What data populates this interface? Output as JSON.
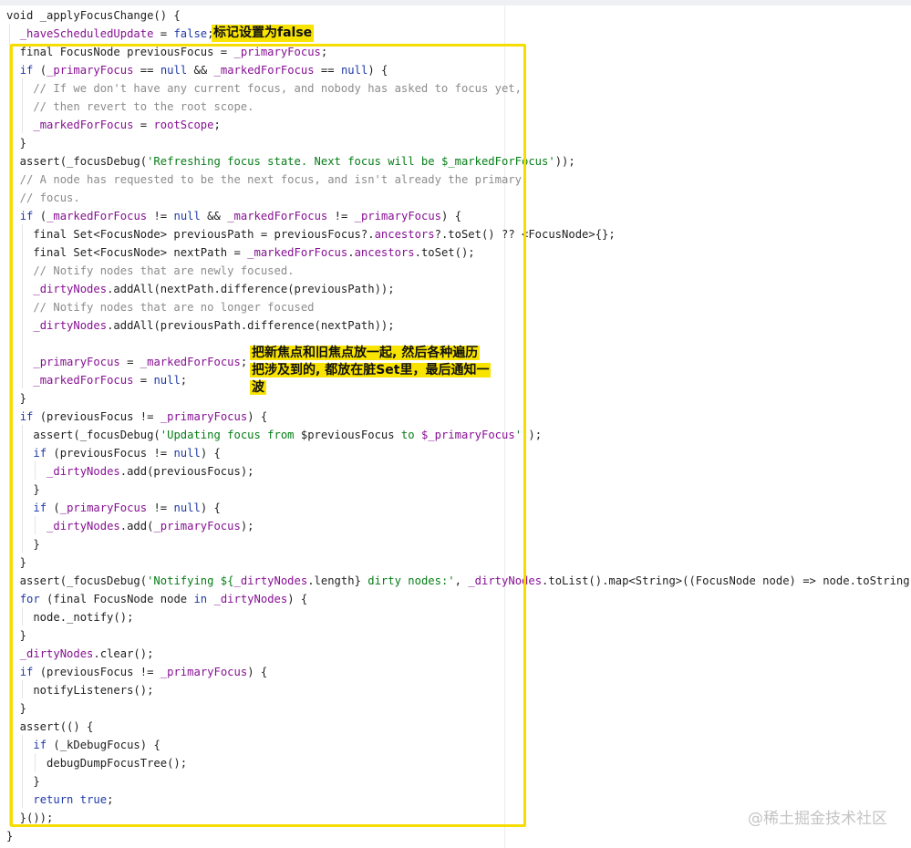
{
  "editor": {
    "lines": [
      [
        {
          "t": "void _applyFocusChange() {",
          "c": ""
        }
      ],
      [
        {
          "t": "  ",
          "c": ""
        },
        {
          "t": "_haveScheduledUpdate",
          "c": "fld"
        },
        {
          "t": " = ",
          "c": ""
        },
        {
          "t": "false",
          "c": "kw"
        },
        {
          "t": ";",
          "c": ""
        }
      ],
      [
        {
          "t": "  final FocusNode previousFocus = ",
          "c": ""
        },
        {
          "t": "_primaryFocus",
          "c": "fld"
        },
        {
          "t": ";",
          "c": ""
        }
      ],
      [
        {
          "t": "  ",
          "c": ""
        },
        {
          "t": "if",
          "c": "kw"
        },
        {
          "t": " (",
          "c": ""
        },
        {
          "t": "_primaryFocus",
          "c": "fld"
        },
        {
          "t": " == ",
          "c": ""
        },
        {
          "t": "null",
          "c": "kw"
        },
        {
          "t": " && ",
          "c": ""
        },
        {
          "t": "_markedForFocus",
          "c": "fld"
        },
        {
          "t": " == ",
          "c": ""
        },
        {
          "t": "null",
          "c": "kw"
        },
        {
          "t": ") {",
          "c": ""
        }
      ],
      [
        {
          "t": "    // If we don't have any current focus, and nobody has asked to focus yet,",
          "c": "cmt"
        }
      ],
      [
        {
          "t": "    // then revert to the root scope.",
          "c": "cmt"
        }
      ],
      [
        {
          "t": "    ",
          "c": ""
        },
        {
          "t": "_markedForFocus",
          "c": "fld"
        },
        {
          "t": " = ",
          "c": ""
        },
        {
          "t": "rootScope",
          "c": "fld"
        },
        {
          "t": ";",
          "c": ""
        }
      ],
      [
        {
          "t": "  }",
          "c": ""
        }
      ],
      [
        {
          "t": "  assert(_focusDebug(",
          "c": ""
        },
        {
          "t": "'Refreshing focus state. Next focus will be $_markedForFocus'",
          "c": "str"
        },
        {
          "t": "));",
          "c": ""
        }
      ],
      [
        {
          "t": "  // A node has requested to be the next focus, and isn't already the primary",
          "c": "cmt"
        }
      ],
      [
        {
          "t": "  // focus.",
          "c": "cmt"
        }
      ],
      [
        {
          "t": "  ",
          "c": ""
        },
        {
          "t": "if",
          "c": "kw"
        },
        {
          "t": " (",
          "c": ""
        },
        {
          "t": "_markedForFocus",
          "c": "fld"
        },
        {
          "t": " != ",
          "c": ""
        },
        {
          "t": "null",
          "c": "kw"
        },
        {
          "t": " && ",
          "c": ""
        },
        {
          "t": "_markedForFocus",
          "c": "fld"
        },
        {
          "t": " != ",
          "c": ""
        },
        {
          "t": "_primaryFocus",
          "c": "fld"
        },
        {
          "t": ") {",
          "c": ""
        }
      ],
      [
        {
          "t": "    final Set<FocusNode> previousPath = previousFocus?.",
          "c": ""
        },
        {
          "t": "ancestors",
          "c": "fld"
        },
        {
          "t": "?.toSet() ?? <FocusNode>{};",
          "c": ""
        }
      ],
      [
        {
          "t": "    final Set<FocusNode> nextPath = ",
          "c": ""
        },
        {
          "t": "_markedForFocus",
          "c": "fld"
        },
        {
          "t": ".",
          "c": ""
        },
        {
          "t": "ancestors",
          "c": "fld"
        },
        {
          "t": ".toSet();",
          "c": ""
        }
      ],
      [
        {
          "t": "    // Notify nodes that are newly focused.",
          "c": "cmt"
        }
      ],
      [
        {
          "t": "    ",
          "c": ""
        },
        {
          "t": "_dirtyNodes",
          "c": "fld"
        },
        {
          "t": ".addAll(nextPath.difference(previousPath));",
          "c": ""
        }
      ],
      [
        {
          "t": "    // Notify nodes that are no longer focused",
          "c": "cmt"
        }
      ],
      [
        {
          "t": "    ",
          "c": ""
        },
        {
          "t": "_dirtyNodes",
          "c": "fld"
        },
        {
          "t": ".addAll(previousPath.difference(nextPath));",
          "c": ""
        }
      ],
      [
        {
          "t": "",
          "c": ""
        }
      ],
      [
        {
          "t": "    ",
          "c": ""
        },
        {
          "t": "_primaryFocus",
          "c": "fld"
        },
        {
          "t": " = ",
          "c": ""
        },
        {
          "t": "_markedForFocus",
          "c": "fld"
        },
        {
          "t": ";",
          "c": ""
        }
      ],
      [
        {
          "t": "    ",
          "c": ""
        },
        {
          "t": "_markedForFocus",
          "c": "fld"
        },
        {
          "t": " = ",
          "c": ""
        },
        {
          "t": "null",
          "c": "kw"
        },
        {
          "t": ";",
          "c": ""
        }
      ],
      [
        {
          "t": "  }",
          "c": ""
        }
      ],
      [
        {
          "t": "  ",
          "c": ""
        },
        {
          "t": "if",
          "c": "kw"
        },
        {
          "t": " (previousFocus != ",
          "c": ""
        },
        {
          "t": "_primaryFocus",
          "c": "fld"
        },
        {
          "t": ") {",
          "c": ""
        }
      ],
      [
        {
          "t": "    assert(_focusDebug(",
          "c": ""
        },
        {
          "t": "'Updating focus from ",
          "c": "str"
        },
        {
          "t": "$previousFocus",
          "c": ""
        },
        {
          "t": " to ",
          "c": "str"
        },
        {
          "t": "$_primaryFocus",
          "c": "fld"
        },
        {
          "t": "'",
          "c": "str"
        },
        {
          "t": "));",
          "c": ""
        }
      ],
      [
        {
          "t": "    ",
          "c": ""
        },
        {
          "t": "if",
          "c": "kw"
        },
        {
          "t": " (previousFocus != ",
          "c": ""
        },
        {
          "t": "null",
          "c": "kw"
        },
        {
          "t": ") {",
          "c": ""
        }
      ],
      [
        {
          "t": "      ",
          "c": ""
        },
        {
          "t": "_dirtyNodes",
          "c": "fld"
        },
        {
          "t": ".add(previousFocus);",
          "c": ""
        }
      ],
      [
        {
          "t": "    }",
          "c": ""
        }
      ],
      [
        {
          "t": "    ",
          "c": ""
        },
        {
          "t": "if",
          "c": "kw"
        },
        {
          "t": " (",
          "c": ""
        },
        {
          "t": "_primaryFocus",
          "c": "fld"
        },
        {
          "t": " != ",
          "c": ""
        },
        {
          "t": "null",
          "c": "kw"
        },
        {
          "t": ") {",
          "c": ""
        }
      ],
      [
        {
          "t": "      ",
          "c": ""
        },
        {
          "t": "_dirtyNodes",
          "c": "fld"
        },
        {
          "t": ".add(",
          "c": ""
        },
        {
          "t": "_primaryFocus",
          "c": "fld"
        },
        {
          "t": ");",
          "c": ""
        }
      ],
      [
        {
          "t": "    }",
          "c": ""
        }
      ],
      [
        {
          "t": "  }",
          "c": ""
        }
      ],
      [
        {
          "t": "  assert(_focusDebug(",
          "c": ""
        },
        {
          "t": "'Notifying ${",
          "c": "str"
        },
        {
          "t": "_dirtyNodes",
          "c": "fld"
        },
        {
          "t": ".length} ",
          "c": ""
        },
        {
          "t": "dirty nodes:'",
          "c": "str"
        },
        {
          "t": ", ",
          "c": ""
        },
        {
          "t": "_dirtyNodes",
          "c": "fld"
        },
        {
          "t": ".toList().map<String>((FocusNode node) => node.toString())));",
          "c": ""
        }
      ],
      [
        {
          "t": "  ",
          "c": ""
        },
        {
          "t": "for",
          "c": "kw"
        },
        {
          "t": " (final FocusNode node ",
          "c": ""
        },
        {
          "t": "in",
          "c": "kw"
        },
        {
          "t": " ",
          "c": ""
        },
        {
          "t": "_dirtyNodes",
          "c": "fld"
        },
        {
          "t": ") {",
          "c": ""
        }
      ],
      [
        {
          "t": "    node._notify();",
          "c": ""
        }
      ],
      [
        {
          "t": "  }",
          "c": ""
        }
      ],
      [
        {
          "t": "  ",
          "c": ""
        },
        {
          "t": "_dirtyNodes",
          "c": "fld"
        },
        {
          "t": ".clear();",
          "c": ""
        }
      ],
      [
        {
          "t": "  ",
          "c": ""
        },
        {
          "t": "if",
          "c": "kw"
        },
        {
          "t": " (previousFocus != ",
          "c": ""
        },
        {
          "t": "_primaryFocus",
          "c": "fld"
        },
        {
          "t": ") {",
          "c": ""
        }
      ],
      [
        {
          "t": "    notifyListeners();",
          "c": ""
        }
      ],
      [
        {
          "t": "  }",
          "c": ""
        }
      ],
      [
        {
          "t": "  assert(() {",
          "c": ""
        }
      ],
      [
        {
          "t": "    ",
          "c": ""
        },
        {
          "t": "if",
          "c": "kw"
        },
        {
          "t": " (_kDebugFocus) {",
          "c": ""
        }
      ],
      [
        {
          "t": "      debugDumpFocusTree();",
          "c": ""
        }
      ],
      [
        {
          "t": "    }",
          "c": ""
        }
      ],
      [
        {
          "t": "    ",
          "c": ""
        },
        {
          "t": "return",
          "c": "kw"
        },
        {
          "t": " ",
          "c": ""
        },
        {
          "t": "true",
          "c": "kw"
        },
        {
          "t": ";",
          "c": ""
        }
      ],
      [
        {
          "t": "  }());",
          "c": ""
        }
      ],
      [
        {
          "t": "}",
          "c": ""
        }
      ]
    ]
  },
  "annotations": {
    "note1": "标记设置为false",
    "note2_line1": "把新焦点和旧焦点放一起, 然后各种遍历",
    "note2_line2": "把涉及到的, 都放在脏Set里，最后通知一",
    "note2_line3": "波"
  },
  "watermark": "@稀土掘金技术社区",
  "colors": {
    "keyword": "#1e3aa8",
    "field": "#871094",
    "string": "#067d17",
    "comment": "#8c8c8c",
    "highlight": "#f7dc00"
  }
}
